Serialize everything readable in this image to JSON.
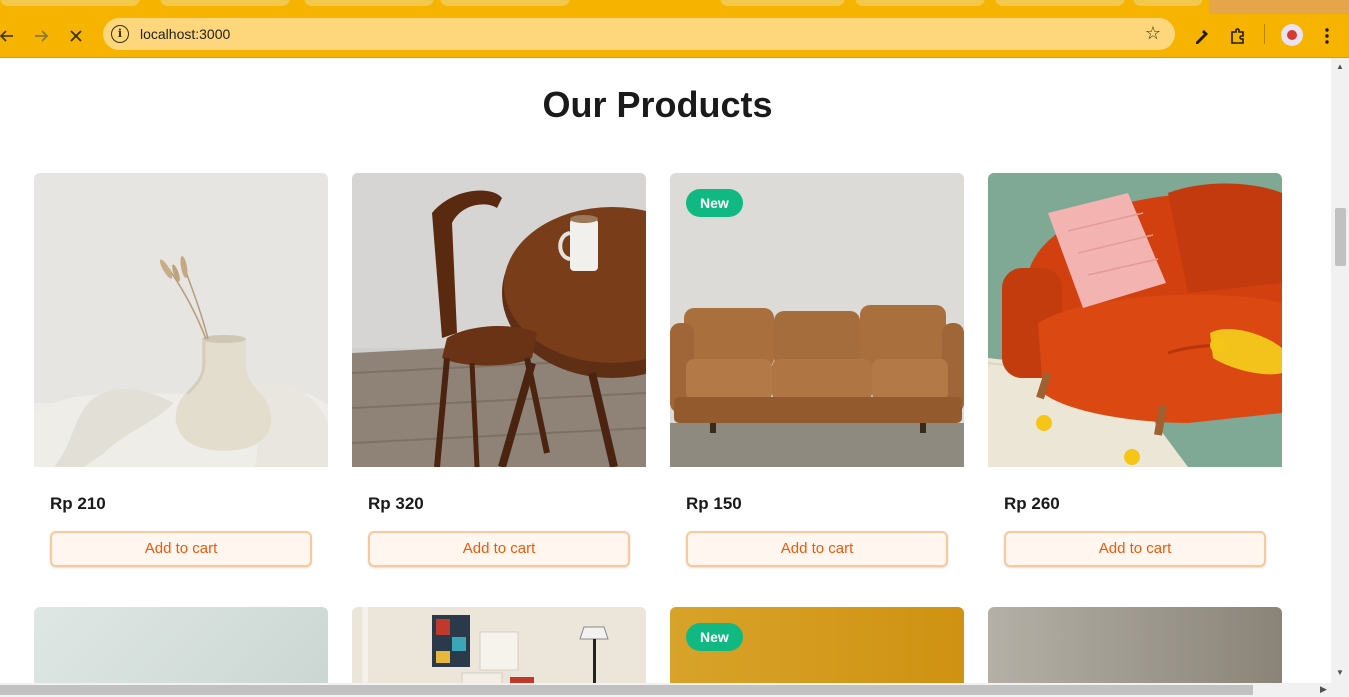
{
  "browser": {
    "url": "localhost:3000",
    "accent": "#f6b300",
    "icons": {
      "back": "arrow-left-icon",
      "forward": "arrow-right-icon",
      "stop": "close-icon",
      "site_info": "info-icon",
      "bookmark": "star-icon",
      "eyedropper": "eyedropper-icon",
      "extensions": "puzzle-icon",
      "menu": "kebab-menu-icon"
    }
  },
  "page": {
    "title": "Our Products"
  },
  "products": [
    {
      "price": "Rp 210",
      "button": "Add to cart",
      "badge": "",
      "image": "ceramic vase with dried grass"
    },
    {
      "price": "Rp 320",
      "button": "Add to cart",
      "badge": "",
      "image": "wooden chair and round table with mug"
    },
    {
      "price": "Rp 150",
      "button": "Add to cart",
      "badge": "New",
      "image": "brown leather sofa"
    },
    {
      "price": "Rp 260",
      "button": "Add to cart",
      "badge": "",
      "image": "orange sofa with pink pillow"
    }
  ],
  "products_row2": [
    {
      "badge": ""
    },
    {
      "badge": ""
    },
    {
      "badge": "New"
    },
    {
      "badge": ""
    }
  ],
  "colors": {
    "badge": "#10b981",
    "button_text": "#ea5a0c",
    "button_border": "#fcc79a",
    "button_bg": "#fff7ef"
  }
}
